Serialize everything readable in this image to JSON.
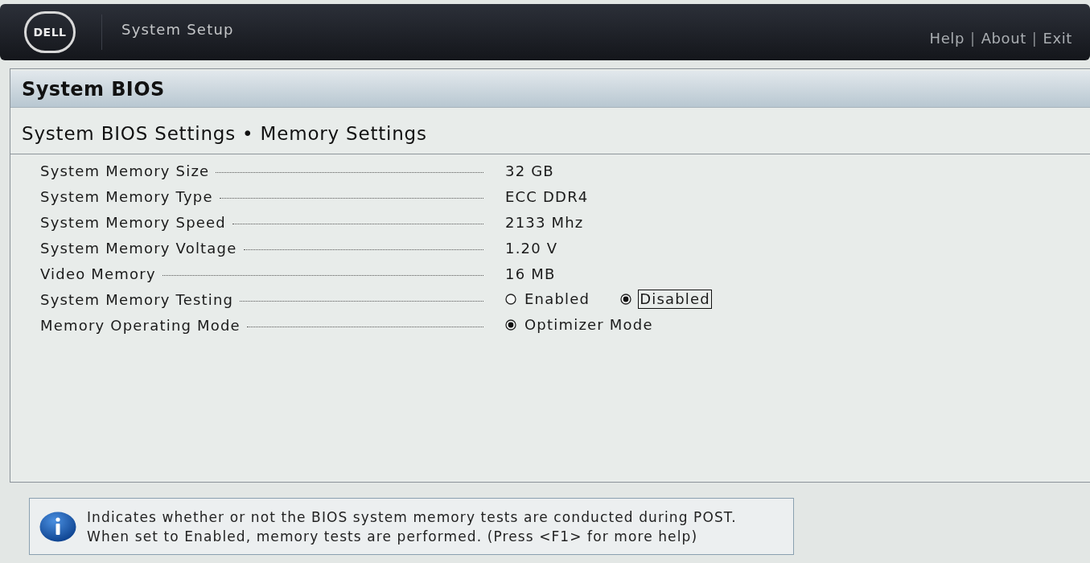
{
  "header": {
    "logo": "DELL",
    "title": "System Setup",
    "links": [
      {
        "label": "Help"
      },
      {
        "label": "About"
      },
      {
        "label": "Exit"
      }
    ],
    "separators": [
      "|",
      "|"
    ]
  },
  "section": {
    "title": "System BIOS"
  },
  "page": {
    "title": "System BIOS Settings • Memory Settings"
  },
  "settings": [
    {
      "label": "System Memory Size",
      "kind": "value",
      "value": "32 GB"
    },
    {
      "label": "System Memory Type",
      "kind": "value",
      "value": "ECC DDR4"
    },
    {
      "label": "System Memory Speed",
      "kind": "value",
      "value": "2133 Mhz"
    },
    {
      "label": "System Memory Voltage",
      "kind": "value",
      "value": "1.20 V"
    },
    {
      "label": "Video Memory",
      "kind": "value",
      "value": "16 MB"
    },
    {
      "label": "System Memory Testing",
      "kind": "radio",
      "options": [
        {
          "label": "Enabled",
          "selected": false,
          "focused": false
        },
        {
          "label": "Disabled",
          "selected": true,
          "focused": true
        }
      ]
    },
    {
      "label": "Memory Operating Mode",
      "kind": "radio",
      "options": [
        {
          "label": "Optimizer Mode",
          "selected": true,
          "focused": false
        }
      ]
    }
  ],
  "help": {
    "lines": [
      "Indicates whether or not the BIOS system memory tests are conducted during POST.",
      "When set to Enabled, memory tests are performed. (Press <F1> for more help)"
    ]
  }
}
